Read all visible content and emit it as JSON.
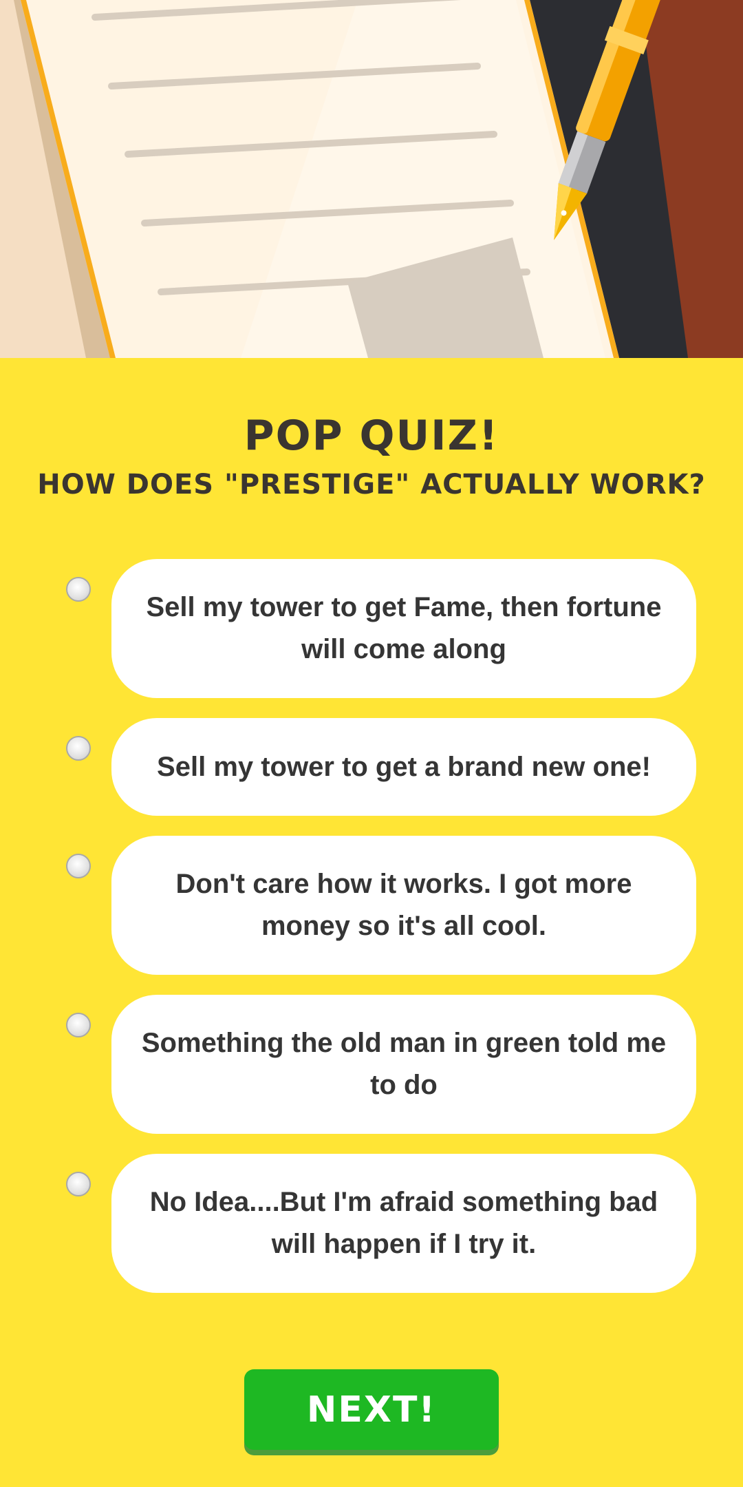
{
  "quiz": {
    "title": "POP QUIZ!",
    "question": "HOW DOES \"PRESTIGE\" ACTUALLY WORK?",
    "options": [
      {
        "label": "Sell my tower to get Fame, then fortune will come along",
        "selected": false
      },
      {
        "label": "Sell my tower to get a brand new one!",
        "selected": false
      },
      {
        "label": "Don't care how it works. I got more money so it's all cool.",
        "selected": false
      },
      {
        "label": "Something the old man in green told me to do",
        "selected": false
      },
      {
        "label": "No Idea....But I'm afraid something bad will happen if I try it.",
        "selected": false
      }
    ],
    "next_label": "NEXT!"
  },
  "colors": {
    "background": "#FFE535",
    "text": "#3A3530",
    "answer_bg": "#FFFFFF",
    "button": "#1EB823",
    "desk": "#8C3B22",
    "paper": "#FFF4E3"
  }
}
